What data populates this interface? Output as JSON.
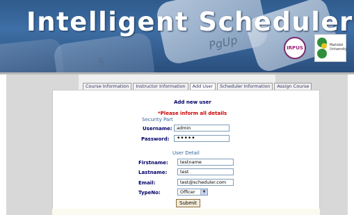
{
  "banner": {
    "title": "Intelligent Scheduler",
    "key_texts": [
      "PgUp",
      "5"
    ],
    "logo1_text": "IRPUS",
    "logo2_text": "Mahidol University"
  },
  "tabs": [
    {
      "label": "Course Information",
      "active": false
    },
    {
      "label": "Instructor Information",
      "active": false
    },
    {
      "label": "Add User",
      "active": true
    },
    {
      "label": "Scheduler Information",
      "active": false
    },
    {
      "label": "Assign Course",
      "active": false
    }
  ],
  "form": {
    "heading": "Add new user",
    "warning": "*Please inform all details",
    "security_section": "Security Part",
    "user_section": "User Detail",
    "username_label": "Username:",
    "username_value": "admin",
    "password_label": "Password:",
    "password_value": "•••••",
    "firstname_label": "Firstname:",
    "firstname_value": "testname",
    "lastname_label": "Lastname:",
    "lastname_value": "test",
    "email_label": "Email:",
    "email_value": "test@scheduler.com",
    "type_label": "TypeNo:",
    "type_value": "Officer",
    "submit_label": "Submit"
  },
  "colors": {
    "heading": "#000066",
    "warning": "#cc0000",
    "section": "#336699",
    "banner": "#3e6fa6"
  }
}
